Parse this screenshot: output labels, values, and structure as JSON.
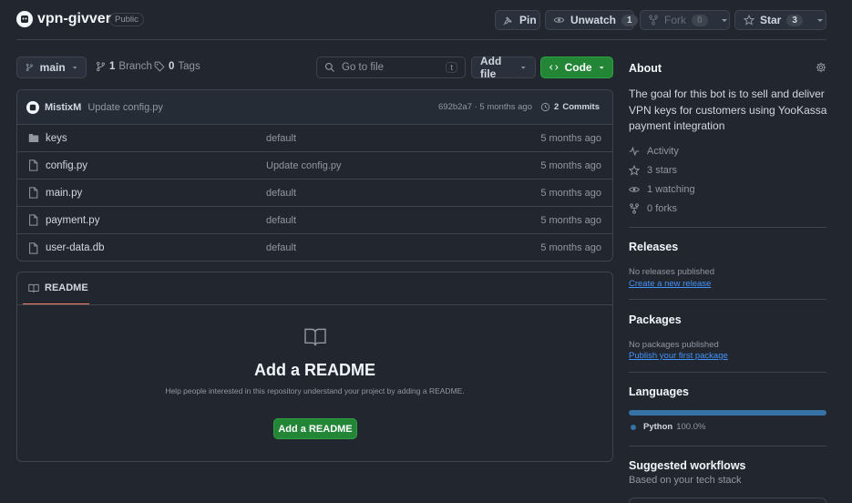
{
  "repo": {
    "name": "vpn-givver",
    "visibility": "Public",
    "avatar_icon": "owner-avatar-icon"
  },
  "actions": {
    "pin": "Pin",
    "unwatch": "Unwatch",
    "unwatch_count": "1",
    "fork": "Fork",
    "fork_count": "0",
    "star": "Star",
    "star_count": "3"
  },
  "toolbar": {
    "branch": "main",
    "branches_count": "1",
    "branches_label": "Branch",
    "tags_count": "0",
    "tags_label": "Tags",
    "search_placeholder": "Go to file",
    "search_shortcut": "t",
    "add_file": "Add file",
    "code": "Code"
  },
  "commit": {
    "author": "MistixM",
    "message": "Update config.py",
    "hash_age": "692b2a7 · 5 months ago",
    "commits_count": "2",
    "commits_label": "Commits"
  },
  "files": [
    {
      "name": "keys",
      "type": "folder",
      "message": "default",
      "age": "5 months ago"
    },
    {
      "name": "config.py",
      "type": "file",
      "message": "Update config.py",
      "age": "5 months ago"
    },
    {
      "name": "main.py",
      "type": "file",
      "message": "default",
      "age": "5 months ago"
    },
    {
      "name": "payment.py",
      "type": "file",
      "message": "default",
      "age": "5 months ago"
    },
    {
      "name": "user-data.db",
      "type": "file",
      "message": "default",
      "age": "5 months ago"
    }
  ],
  "readme": {
    "tab": "README",
    "heading": "Add a README",
    "help": "Help people interested in this repository understand your project by adding a README.",
    "button": "Add a README"
  },
  "about": {
    "title": "About",
    "description": "The goal for this bot is to sell and deliver VPN keys for customers using YooKassa payment integration",
    "activity": "Activity",
    "stars_count": "3",
    "stars_label": "stars",
    "watching_count": "1",
    "watching_label": "watching",
    "forks_count": "0",
    "forks_label": "forks"
  },
  "releases": {
    "title": "Releases",
    "empty": "No releases published",
    "link": "Create a new release"
  },
  "packages": {
    "title": "Packages",
    "empty": "No packages published",
    "link": "Publish your first package"
  },
  "languages": {
    "title": "Languages",
    "items": [
      {
        "name": "Python",
        "percent": "100.0%",
        "fraction": 1.0,
        "color": "#3572A5"
      }
    ]
  },
  "workflows": {
    "title": "Suggested workflows",
    "subtitle": "Based on your tech stack"
  },
  "colors": {
    "accent_green": "#238636",
    "link": "#4493f8",
    "readme_tab_underline": "#f78166"
  }
}
